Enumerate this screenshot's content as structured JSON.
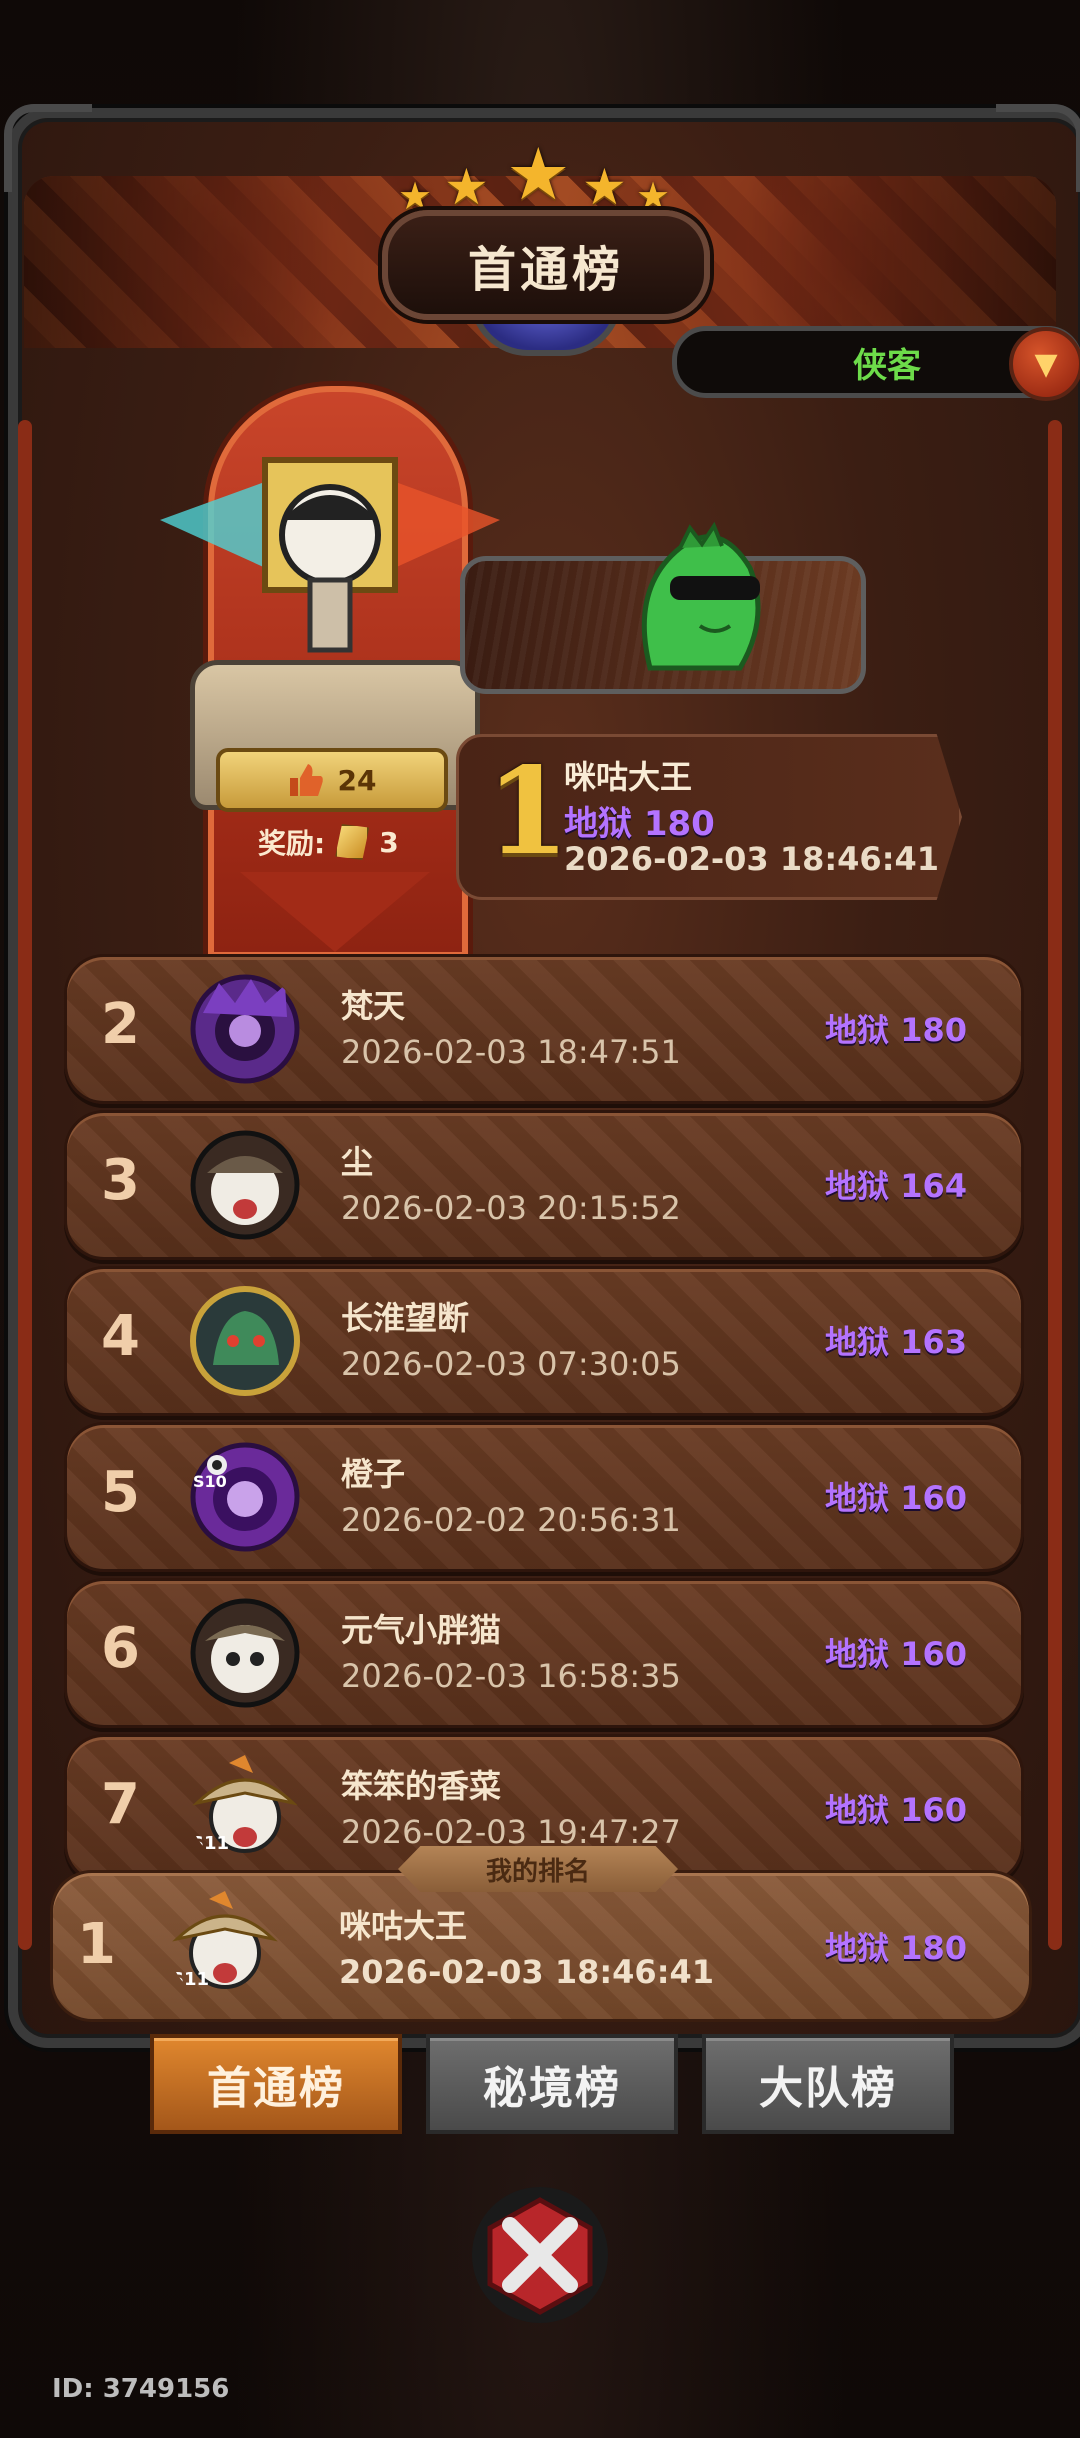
{
  "board": {
    "title": "首通榜",
    "class_filter": "侠客",
    "stars": 5
  },
  "champion": {
    "rank": "1",
    "name": "咪咕大王",
    "score": "地狱 180",
    "time": "2026-02-03 18:46:41",
    "likes": "24",
    "reward_label": "奖励:",
    "reward_count": "3"
  },
  "rows": [
    {
      "rank": "2",
      "name": "梵天",
      "time": "2026-02-03 18:47:51",
      "score": "地狱 180",
      "avatar": "purple-dragon-avatar"
    },
    {
      "rank": "3",
      "name": "尘",
      "time": "2026-02-03 20:15:52",
      "score": "地狱 164",
      "avatar": "panda-hat-avatar"
    },
    {
      "rank": "4",
      "name": "长淮望断",
      "time": "2026-02-03 07:30:05",
      "score": "地狱 163",
      "avatar": "green-beast-avatar"
    },
    {
      "rank": "5",
      "name": "橙子",
      "time": "2026-02-02 20:56:31",
      "score": "地狱 160",
      "avatar": "purple-eye-avatar",
      "badge": "S10"
    },
    {
      "rank": "6",
      "name": "元气小胖猫",
      "time": "2026-02-03 16:58:35",
      "score": "地狱 160",
      "avatar": "panda-hat-avatar"
    },
    {
      "rank": "7",
      "name": "笨笨的香菜",
      "time": "2026-02-03 19:47:27",
      "score": "地狱 160",
      "avatar": "panda-straw-hat-avatar",
      "badge": "S11"
    }
  ],
  "my_rank": {
    "tag": "我的排名",
    "rank": "1",
    "name": "咪咕大王",
    "time": "2026-02-03 18:46:41",
    "score": "地狱 180",
    "badge": "S11"
  },
  "tabs": [
    "首通榜",
    "秘境榜",
    "大队榜"
  ],
  "active_tab": 0,
  "player_id": "ID: 3749156",
  "colors": {
    "score_purple": "#b473ff",
    "rank_gold": "#f0c240",
    "class_green": "#6ddc4a",
    "tab_active": "#d2782a"
  }
}
